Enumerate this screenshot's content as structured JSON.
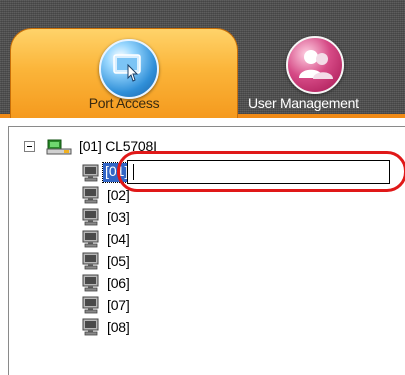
{
  "tabs": [
    {
      "label": "Port Access",
      "icon": "port-access-icon",
      "active": true
    },
    {
      "label": "User Management",
      "icon": "user-management-icon",
      "active": false
    }
  ],
  "tree": {
    "root": {
      "label": "[01] CL5708I",
      "expanded": true
    },
    "selected_port_label": "[01]",
    "rename_value": "",
    "ports": [
      "[02]",
      "[03]",
      "[04]",
      "[05]",
      "[06]",
      "[07]",
      "[08]"
    ]
  },
  "colors": {
    "active_tab": "#f59a1e",
    "header_background": "#545454",
    "selection": "#3165c6",
    "annotation_highlight": "#e01818"
  }
}
